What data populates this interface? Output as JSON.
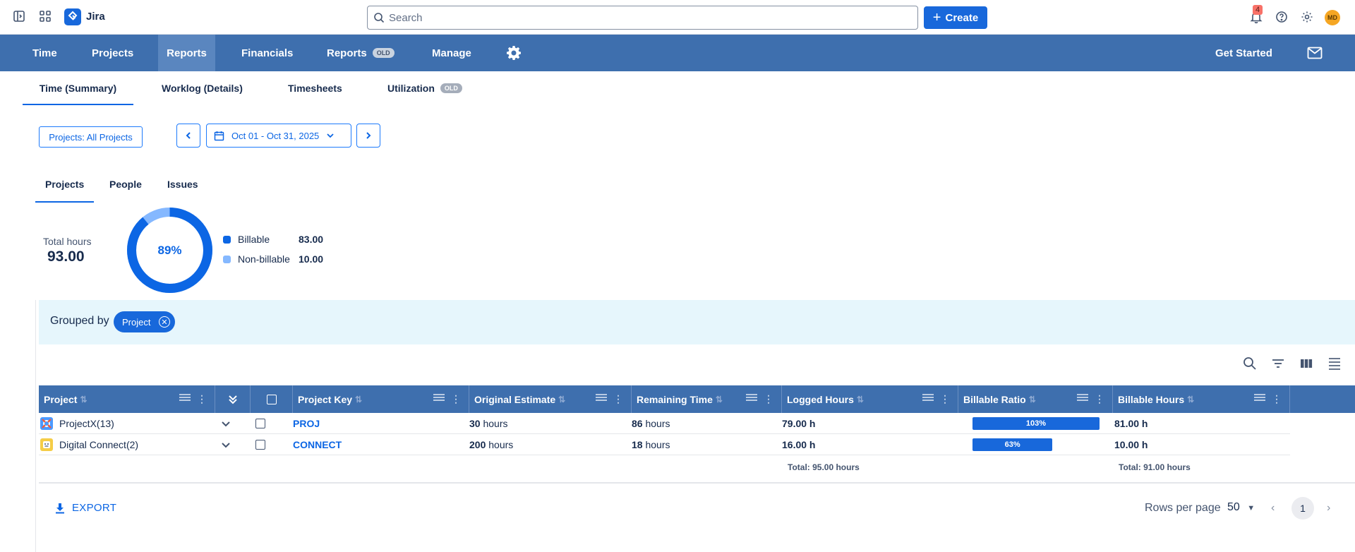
{
  "topbar": {
    "app_name": "Jira",
    "search_placeholder": "Search",
    "create_label": "Create",
    "notification_count": "4",
    "avatar_initials": "MD"
  },
  "nav": {
    "items": [
      {
        "label": "Time"
      },
      {
        "label": "Projects"
      },
      {
        "label": "Reports",
        "active": true
      },
      {
        "label": "Financials"
      },
      {
        "label": "Reports",
        "badge": "OLD"
      },
      {
        "label": "Manage"
      }
    ],
    "get_started": "Get Started"
  },
  "subtabs": [
    {
      "label": "Time (Summary)",
      "active": true
    },
    {
      "label": "Worklog (Details)"
    },
    {
      "label": "Timesheets"
    },
    {
      "label": "Utilization",
      "badge": "OLD"
    }
  ],
  "filters": {
    "projects": "Projects: All Projects",
    "date_range": "Oct 01 - Oct 31, 2025"
  },
  "content_tabs": [
    {
      "label": "Projects",
      "active": true
    },
    {
      "label": "People"
    },
    {
      "label": "Issues"
    }
  ],
  "summary": {
    "total_label": "Total hours",
    "total_value": "93.00",
    "billable_percent": "89%",
    "billable_fraction": 0.89,
    "legend": [
      {
        "label": "Billable",
        "value": "83.00",
        "color": "#0c66e4"
      },
      {
        "label": "Non-billable",
        "value": "10.00",
        "color": "#85b8ff"
      }
    ]
  },
  "grouping": {
    "label": "Grouped by",
    "chip": "Project"
  },
  "table": {
    "columns": [
      "Project",
      "Project Key",
      "Original Estimate",
      "Remaining Time",
      "Logged Hours",
      "Billable Ratio",
      "Billable Hours"
    ],
    "rows": [
      {
        "project": "ProjectX(13)",
        "key": "PROJ",
        "estimate_num": "30",
        "estimate_unit": "hours",
        "remaining_num": "86",
        "remaining_unit": "hours",
        "logged": "79.00 h",
        "ratio": "103%",
        "ratio_fill": 1.0,
        "billable": "81.00 h",
        "icon_color": "#4c9aff"
      },
      {
        "project": "Digital Connect(2)",
        "key": "CONNECT",
        "estimate_num": "200",
        "estimate_unit": "hours",
        "remaining_num": "18",
        "remaining_unit": "hours",
        "logged": "16.00 h",
        "ratio": "63%",
        "ratio_fill": 0.63,
        "billable": "10.00 h",
        "icon_color": "#f5cd47"
      }
    ],
    "total_logged": "Total: 95.00 hours",
    "total_billable": "Total: 91.00 hours"
  },
  "footer": {
    "export_label": "EXPORT",
    "rows_per_page_label": "Rows per page",
    "rows_per_page_value": "50",
    "current_page": "1"
  }
}
